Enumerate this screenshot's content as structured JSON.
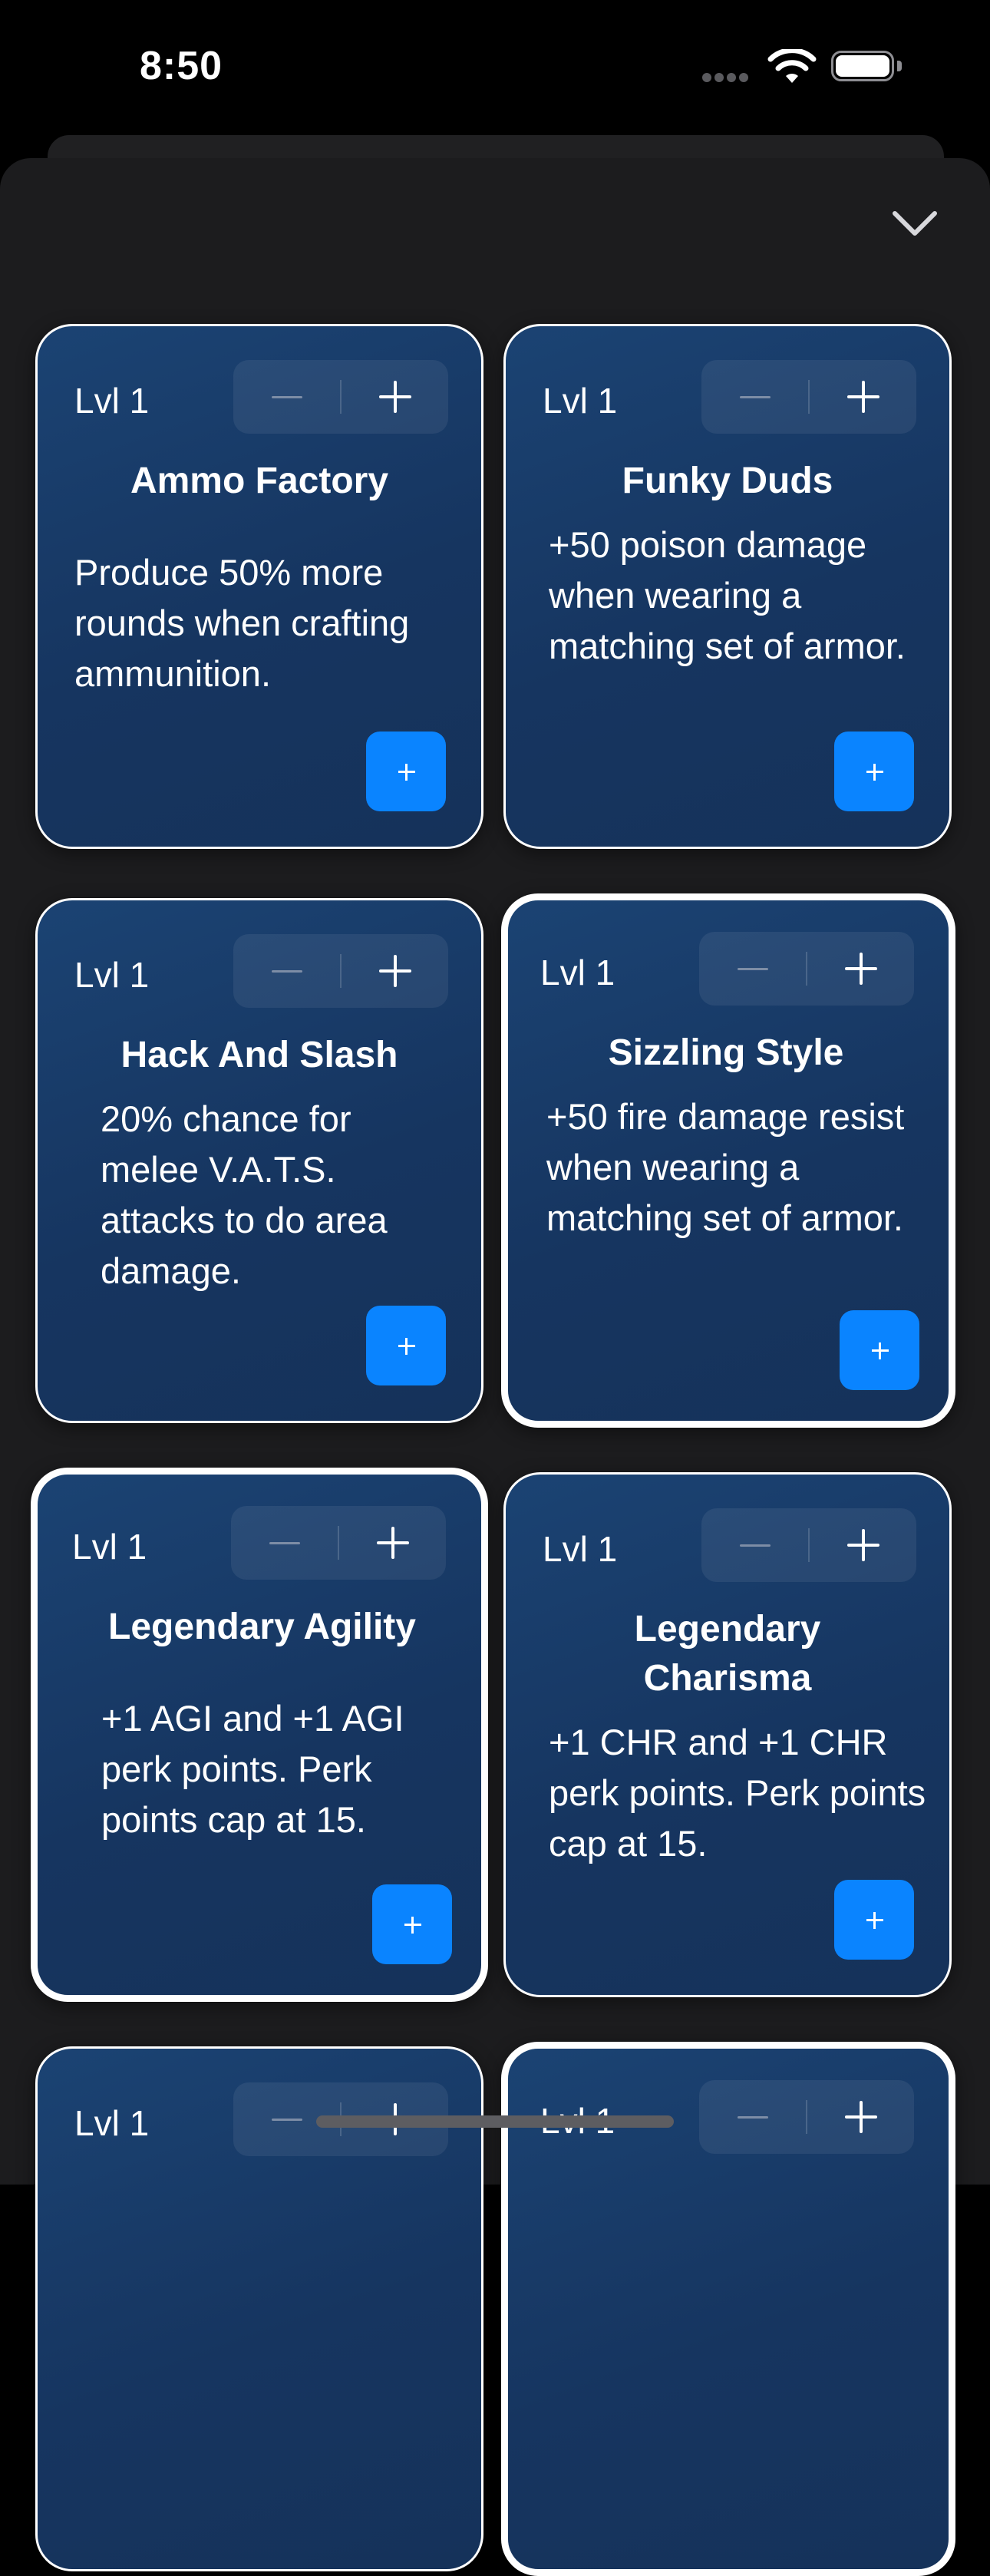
{
  "status_bar": {
    "time": "8:50"
  },
  "sheet": {
    "collapse_icon": "chevron-down-icon"
  },
  "colors": {
    "card_gradient_top": "#1b4373",
    "card_gradient_bottom": "#15325a",
    "card_border": "#ffffff",
    "add_button": "#0a84ff",
    "sheet_background": "#1c1c1e"
  },
  "cards": [
    {
      "level": "Lvl 1",
      "title": "Ammo Factory",
      "description": "Produce 50% more rounds when crafting ammunition.",
      "selected": false
    },
    {
      "level": "Lvl 1",
      "title": "Funky Duds",
      "description": "+50 poison damage when wearing a matching set of armor.",
      "selected": false
    },
    {
      "level": "Lvl 1",
      "title": "Hack And Slash",
      "description": "20% chance for melee V.A.T.S. attacks to do area damage.",
      "selected": false
    },
    {
      "level": "Lvl 1",
      "title": "Sizzling Style",
      "description": "+50 fire damage resist when wearing a matching set of armor.",
      "selected": true
    },
    {
      "level": "Lvl 1",
      "title": "Legendary Agility",
      "description": "+1 AGI and +1 AGI perk points. Perk points cap at 15.",
      "selected": true
    },
    {
      "level": "Lvl 1",
      "title": "Legendary Charisma",
      "description": "+1 CHR and +1 CHR perk points. Perk points cap at 15.",
      "selected": false
    },
    {
      "level": "Lvl 1",
      "selected": false
    },
    {
      "level": "Lvl 1",
      "selected": true
    }
  ]
}
